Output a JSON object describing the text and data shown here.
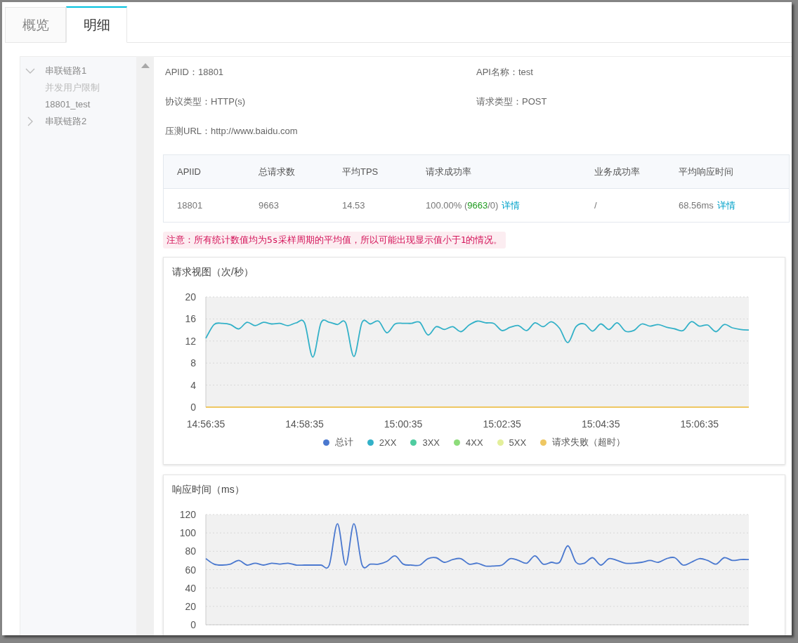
{
  "tabs": [
    {
      "label": "概览",
      "selected": false
    },
    {
      "label": "明细",
      "selected": true
    }
  ],
  "tree": [
    {
      "label": "串联链路1",
      "expanded": true,
      "children": [
        {
          "label": "并发用户限制",
          "disabled": true
        },
        {
          "label": "18801_test",
          "disabled": false
        }
      ]
    },
    {
      "label": "串联链路2",
      "expanded": false
    }
  ],
  "info": [
    "APIID：18801",
    "API名称：test",
    "协议类型：HTTP(s)",
    "请求类型：POST",
    "压测URL：http://www.baidu.com"
  ],
  "table": {
    "columns": [
      "APIID",
      "总请求数",
      "平均TPS",
      "请求成功率",
      "业务成功率",
      "平均响应时间"
    ],
    "rows": [
      [
        {
          "text": "18801"
        },
        {
          "text": "9663"
        },
        {
          "text": "14.53"
        },
        {
          "text": "100.00% (",
          "highlight": "9663",
          "suffix": "/0)",
          "link": "详情"
        },
        {
          "text": "/"
        },
        {
          "text": "68.56ms",
          "link": "详情"
        }
      ]
    ]
  },
  "note": "注意：所有统计数值均为5s采样周期的平均值，所以可能出现显示值小于1的情况。",
  "charts": [
    {
      "chart_data": {
        "type": "line",
        "title": "请求视图（次/秒）",
        "ylim": [
          0,
          20
        ],
        "yticks": [
          0,
          4,
          8,
          12,
          16,
          20
        ],
        "grid": true,
        "legend": true,
        "categories": [
          "14:56:35",
          null,
          null,
          null,
          null,
          null,
          null,
          null,
          null,
          null,
          null,
          null,
          "14:58:35",
          null,
          null,
          null,
          null,
          null,
          null,
          null,
          null,
          null,
          null,
          null,
          "15:00:35",
          null,
          null,
          null,
          null,
          null,
          null,
          null,
          null,
          null,
          null,
          null,
          "15:02:35",
          null,
          null,
          null,
          null,
          null,
          null,
          null,
          null,
          null,
          null,
          null,
          "15:04:35",
          null,
          null,
          null,
          null,
          null,
          null,
          null,
          null,
          null,
          null,
          null,
          "15:06:35",
          null,
          null,
          null,
          null,
          null,
          null
        ],
        "series": [
          {
            "name": "总计",
            "color": "#4a78cf",
            "values": [
              null,
              null,
              null,
              null,
              null,
              null,
              null,
              null,
              null,
              null,
              null,
              null,
              null,
              null,
              null,
              null,
              null,
              null,
              null,
              null,
              null,
              null,
              null,
              null,
              null,
              null,
              null,
              null,
              null,
              null,
              null,
              null,
              null,
              null,
              null,
              null,
              null,
              null,
              null,
              null,
              null,
              null,
              null,
              null,
              null,
              null,
              null,
              null,
              null,
              null,
              null,
              null,
              null,
              null,
              null,
              null,
              null,
              null,
              null,
              null,
              null,
              null,
              null,
              null,
              null,
              null,
              null
            ]
          },
          {
            "name": "2XX",
            "color": "#33b1c8",
            "values": [
              12.5,
              15,
              15.2,
              15,
              14.2,
              15.4,
              14.8,
              15.4,
              15.1,
              15.2,
              14.8,
              15.3,
              15.3,
              9.1,
              15.3,
              15.4,
              15,
              15.3,
              9.2,
              15.4,
              15.1,
              15.6,
              13.5,
              15.1,
              15.2,
              15.2,
              15.4,
              13.1,
              14.6,
              14.1,
              14.6,
              13.7,
              14.9,
              15.6,
              15.3,
              15.2,
              13.9,
              14.5,
              14.8,
              13.9,
              15.3,
              14.6,
              15.5,
              14.3,
              11.7,
              14.6,
              15.1,
              13.8,
              15.1,
              14.1,
              15.3,
              13.8,
              13.9,
              15.1,
              14.7,
              15,
              14.5,
              14.2,
              13.9,
              15.5,
              14.7,
              14.9,
              13.7,
              15,
              14.4,
              14.1,
              14
            ]
          },
          {
            "name": "3XX",
            "color": "#4fcca0",
            "values": [
              null,
              null,
              null,
              null,
              null,
              null,
              null,
              null,
              null,
              null,
              null,
              null,
              null,
              null,
              null,
              null,
              null,
              null,
              null,
              null,
              null,
              null,
              null,
              null,
              null,
              null,
              null,
              null,
              null,
              null,
              null,
              null,
              null,
              null,
              null,
              null,
              null,
              null,
              null,
              null,
              null,
              null,
              null,
              null,
              null,
              null,
              null,
              null,
              null,
              null,
              null,
              null,
              null,
              null,
              null,
              null,
              null,
              null,
              null,
              null,
              null,
              null,
              null,
              null,
              null,
              null,
              null
            ]
          },
          {
            "name": "4XX",
            "color": "#8ddc7a",
            "values": [
              null,
              null,
              null,
              null,
              null,
              null,
              null,
              null,
              null,
              null,
              null,
              null,
              null,
              null,
              null,
              null,
              null,
              null,
              null,
              null,
              null,
              null,
              null,
              null,
              null,
              null,
              null,
              null,
              null,
              null,
              null,
              null,
              null,
              null,
              null,
              null,
              null,
              null,
              null,
              null,
              null,
              null,
              null,
              null,
              null,
              null,
              null,
              null,
              null,
              null,
              null,
              null,
              null,
              null,
              null,
              null,
              null,
              null,
              null,
              null,
              null,
              null,
              null,
              null,
              null,
              null,
              null
            ]
          },
          {
            "name": "5XX",
            "color": "#e3ef9a",
            "values": [
              null,
              null,
              null,
              null,
              null,
              null,
              null,
              null,
              null,
              null,
              null,
              null,
              null,
              null,
              null,
              null,
              null,
              null,
              null,
              null,
              null,
              null,
              null,
              null,
              null,
              null,
              null,
              null,
              null,
              null,
              null,
              null,
              null,
              null,
              null,
              null,
              null,
              null,
              null,
              null,
              null,
              null,
              null,
              null,
              null,
              null,
              null,
              null,
              null,
              null,
              null,
              null,
              null,
              null,
              null,
              null,
              null,
              null,
              null,
              null,
              null,
              null,
              null,
              null,
              null,
              null,
              null
            ]
          },
          {
            "name": "请求失败（超时）",
            "color": "#eec762",
            "values": [
              0,
              0,
              0,
              0,
              0,
              0,
              0,
              0,
              0,
              0,
              0,
              0,
              0,
              0,
              0,
              0,
              0,
              0,
              0,
              0,
              0,
              0,
              0,
              0,
              0,
              0,
              0,
              0,
              0,
              0,
              0,
              0,
              0,
              0,
              0,
              0,
              0,
              0,
              0,
              0,
              0,
              0,
              0,
              0,
              0,
              0,
              0,
              0,
              0,
              0,
              0,
              0,
              0,
              0,
              0,
              0,
              0,
              0,
              0,
              0,
              0,
              0,
              0,
              0,
              0,
              0,
              0
            ]
          }
        ]
      }
    },
    {
      "chart_data": {
        "type": "line",
        "title": "响应时间（ms）",
        "ylim": [
          0,
          120
        ],
        "yticks": [
          0,
          20,
          40,
          60,
          80,
          100,
          120
        ],
        "grid": true,
        "series": [
          {
            "color": "#4a78cf",
            "values": [
              72,
              66,
              65,
              66,
              70,
              65,
              67,
              65,
              67,
              66,
              67,
              65,
              65,
              65,
              65,
              65,
              110,
              65,
              110,
              65,
              66,
              66,
              69,
              75,
              66,
              65,
              65,
              72,
              73,
              68,
              71,
              72,
              66,
              67,
              64,
              64,
              65,
              72,
              70,
              67,
              75,
              66,
              68,
              68,
              86,
              68,
              67,
              73,
              65,
              72,
              70,
              67,
              67,
              68,
              70,
              68,
              72,
              73,
              65,
              68,
              72,
              70,
              66,
              73,
              70,
              71,
              71
            ]
          }
        ]
      }
    }
  ]
}
